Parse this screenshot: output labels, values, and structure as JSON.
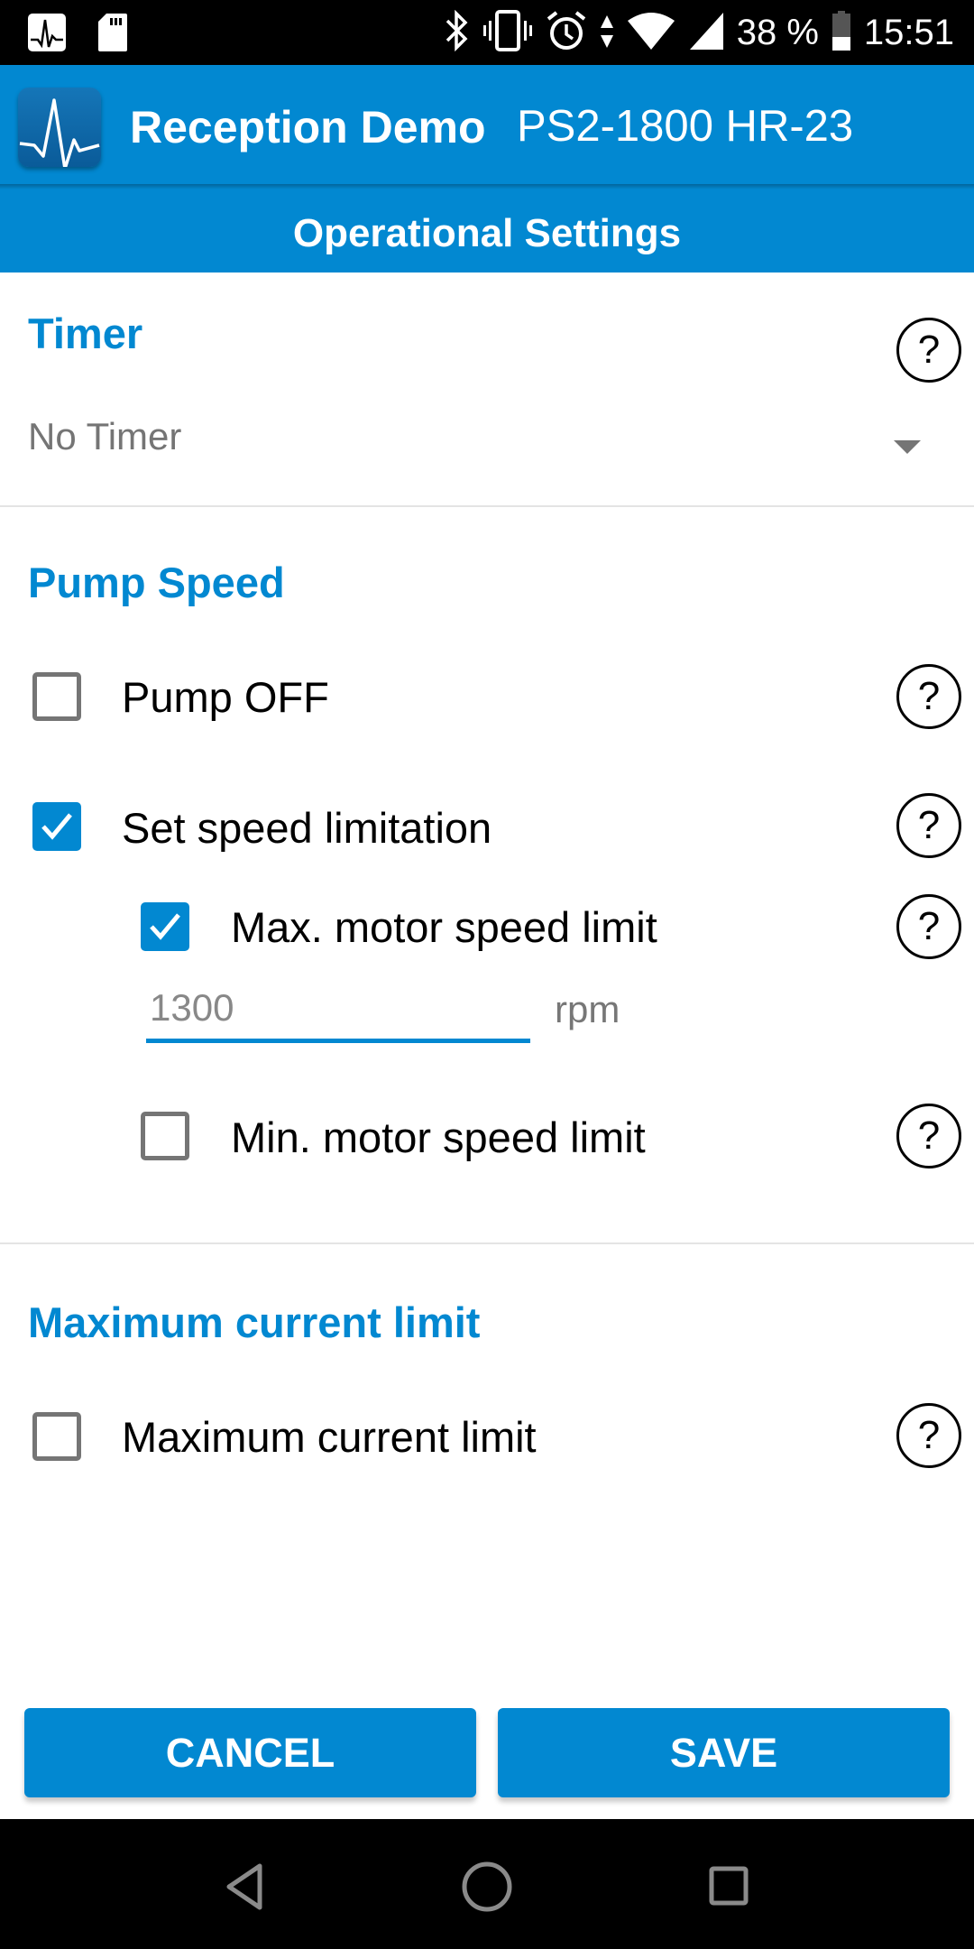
{
  "status_bar": {
    "left_icons": [
      "heartbeat-app-notification-icon",
      "sd-card-icon"
    ],
    "right_icons": [
      "bluetooth-icon",
      "vibrate-icon",
      "alarm-icon",
      "data-transfer-icon",
      "wifi-icon",
      "cell-signal-icon",
      "battery-icon"
    ],
    "battery_percent_label": "38 %",
    "battery_level": 0.38,
    "time": "15:51"
  },
  "app_bar": {
    "logo_icon": "heartbeat-logo-icon",
    "title": "Reception Demo",
    "subtitle": "PS2-1800 HR-23"
  },
  "screen": {
    "title": "Operational Settings"
  },
  "timer": {
    "section_title": "Timer",
    "help_label": "?",
    "dropdown_value": "No Timer"
  },
  "pump_speed": {
    "section_title": "Pump Speed",
    "options": [
      {
        "label": "Pump OFF",
        "checked": false,
        "help_label": "?"
      },
      {
        "label": "Set speed limitation",
        "checked": true,
        "help_label": "?"
      }
    ],
    "max_limit": {
      "label": "Max. motor speed limit",
      "checked": true,
      "help_label": "?",
      "placeholder": "1300",
      "value": "",
      "unit": "rpm"
    },
    "min_limit": {
      "label": "Min. motor speed limit",
      "checked": false,
      "help_label": "?"
    }
  },
  "max_current": {
    "section_title": "Maximum current limit",
    "option": {
      "label": "Maximum current limit",
      "checked": false,
      "help_label": "?"
    }
  },
  "actions": {
    "cancel_label": "CANCEL",
    "save_label": "SAVE"
  },
  "nav_bar": {
    "buttons": [
      "back-icon",
      "home-icon",
      "recents-icon"
    ]
  },
  "colors": {
    "accent": "#0288d1",
    "checkbox_unchecked": "#757575",
    "status_bar": "#000000"
  }
}
